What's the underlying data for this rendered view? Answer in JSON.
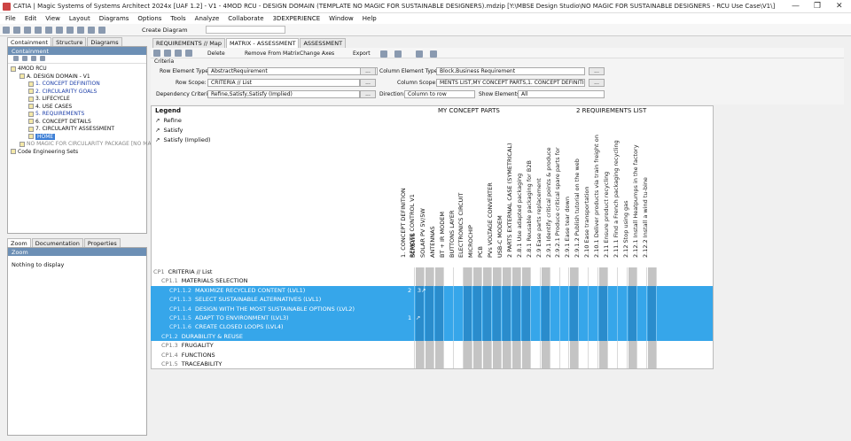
{
  "title": {
    "text": "CATIA | Magic Systems of Systems Architect 2024x [UAF 1.2] - V1 - 4MOD RCU - DESIGN DOMAIN (TEMPLATE NO MAGIC FOR SUSTAINABLE DESIGNERS).mdzip [Y:\\MBSE Design Studio\\NO MAGIC FOR SUSTAINABLE DESIGNERS - RCU Use Case\\V1\\]",
    "minimize": "—",
    "restore": "❐",
    "close": "✕"
  },
  "menu": [
    "File",
    "Edit",
    "View",
    "Layout",
    "Diagrams",
    "Options",
    "Tools",
    "Analyze",
    "Collaborate",
    "3DEXPERIENCE",
    "Window",
    "Help"
  ],
  "toolbar": {
    "create_diagram": "Create Diagram"
  },
  "left_tabs": [
    "Containment",
    "Structure",
    "Diagrams"
  ],
  "containment": {
    "title": "Containment",
    "tree": [
      {
        "label": "4MOD RCU",
        "indent": 0,
        "cls": ""
      },
      {
        "label": "A. DESIGN DOMAIN - V1",
        "indent": 1,
        "cls": ""
      },
      {
        "label": "1. CONCEPT DEFINITION",
        "indent": 2,
        "cls": "blue"
      },
      {
        "label": "2. CIRCULARITY GOALS",
        "indent": 2,
        "cls": "blue"
      },
      {
        "label": "3. LIFECYCLE",
        "indent": 2,
        "cls": ""
      },
      {
        "label": "4. USE CASES",
        "indent": 2,
        "cls": ""
      },
      {
        "label": "5. REQUIREMENTS",
        "indent": 2,
        "cls": "blue"
      },
      {
        "label": "6. CONCEPT DETAILS",
        "indent": 2,
        "cls": ""
      },
      {
        "label": "7. CIRCULARITY ASSESSMENT",
        "indent": 2,
        "cls": ""
      },
      {
        "label": "HOME",
        "indent": 2,
        "cls": "sel"
      },
      {
        "label": "NO MAGIC FOR CIRCULARITY PACKAGE [NO MA",
        "indent": 1,
        "cls": "grey"
      },
      {
        "label": "Code Engineering Sets",
        "indent": 0,
        "cls": ""
      }
    ]
  },
  "bottom_tabs": [
    "Zoom",
    "Documentation",
    "Properties"
  ],
  "zoom": {
    "title": "Zoom",
    "empty": "Nothing to display"
  },
  "editor_tabs": [
    "REQUIREMENTS // Map",
    "MATRIX - ASSESSMENT",
    "ASSESSMENT"
  ],
  "matrix_toolbar": {
    "delete": "Delete",
    "remove": "Remove From Matrix",
    "change_axes": "Change Axes",
    "export": "Export"
  },
  "criteria": {
    "heading": "Criteria",
    "row_type_label": "Row Element Type:",
    "row_type_value": "AbstractRequirement",
    "row_scope_label": "Row Scope:",
    "row_scope_value": "CRITERIA // List",
    "dep_label": "Dependency Criteria:",
    "dep_value": "Refine,Satisfy,Satisfy (Implied)",
    "col_type_label": "Column Element Type:",
    "col_type_value": "Block,Business Requirement",
    "col_scope_label": "Column Scope:",
    "col_scope_value": "MENTS LIST,MY CONCEPT PARTS,1. CONCEPT DEFINITION",
    "direction_label": "Direction:",
    "direction_value": "Column to row",
    "show_label": "Show Elements:",
    "show_value": "All",
    "dots": "...",
    "sn": "(S)"
  },
  "legend": {
    "title": "Legend",
    "items": [
      "Refine",
      "Satisfy",
      "Satisfy (Implied)"
    ]
  },
  "col_groups": {
    "parts": "MY CONCEPT PARTS",
    "reqs": "2 REQUIREMENTS LIST"
  },
  "columns": [
    {
      "label": "1. CONCEPT DEFINITION",
      "sub": "REMOTE CONTROL V1"
    },
    {
      "label": "SCREWS"
    },
    {
      "label": "SOLAR PV 5V/5W"
    },
    {
      "label": "ANTENNAS"
    },
    {
      "label": "BT + IR MODEM"
    },
    {
      "label": "BUTTONS LAYER"
    },
    {
      "label": "ELECTRONICS CIRCUIT"
    },
    {
      "label": "MICROCHIP"
    },
    {
      "label": "PCB"
    },
    {
      "label": "PVs VOLTAGE CONVERTER"
    },
    {
      "label": "USB-C MODEM"
    },
    {
      "label": "2 PARTS EXTERNAL CASE (SYMETRICAL)"
    },
    {
      "label": "2.8.1 Use adapted packaging"
    },
    {
      "label": "2.8.1 Reusable packaging for B2B"
    },
    {
      "label": "2.9 Ease parts replacement"
    },
    {
      "label": "2.9.1 Identify critical points & produce"
    },
    {
      "label": "2.9.2.1 Produce critical spare parts for"
    },
    {
      "label": "2.9.1 Ease tear down"
    },
    {
      "label": "2.9.1.2 Publish tutorial on the web"
    },
    {
      "label": "2.10 Ease transportation"
    },
    {
      "label": "2.10.1 Deliver products via train freight on"
    },
    {
      "label": "2.11 Ensure product recycling"
    },
    {
      "label": "2.11.1 Find a French packaging recycling"
    },
    {
      "label": "2.12 Stop using gas"
    },
    {
      "label": "2.12.1 Install Heatpumps in the factory"
    },
    {
      "label": "2.12.2 Install a wind tu-bine"
    }
  ],
  "rows": [
    {
      "code": "CP1",
      "label": "CRITERIA // List",
      "indent": 0,
      "sel": false
    },
    {
      "code": "CP1.1",
      "label": "MATERIALS SELECTION",
      "indent": 1,
      "sel": false
    },
    {
      "code": "CP1.1.2",
      "label": "MAXIMIZE RECYCLED CONTENT (LVL1)",
      "indent": 2,
      "sel": true,
      "count": "2",
      "n3": "3"
    },
    {
      "code": "CP1.1.3",
      "label": "SELECT SUSTAINABLE ALTERNATIVES (LVL1)",
      "indent": 2,
      "sel": true
    },
    {
      "code": "CP1.1.4",
      "label": "DESIGN WITH THE MOST SUSTAINABLE OPTIONS (LVL2)",
      "indent": 2,
      "sel": true
    },
    {
      "code": "CP1.1.5",
      "label": "ADAPT TO ENVIRONMENT (LVL3)",
      "indent": 2,
      "sel": true,
      "count": "1"
    },
    {
      "code": "CP1.1.6",
      "label": "CREATE CLOSED LOOPS (LVL4)",
      "indent": 2,
      "sel": true
    },
    {
      "code": "CP1.2",
      "label": "DURABILITY & REUSE",
      "indent": 1,
      "sel": true
    },
    {
      "code": "CP1.3",
      "label": "FRUGALITY",
      "indent": 1,
      "sel": false
    },
    {
      "code": "CP1.4",
      "label": "FUNCTIONS",
      "indent": 1,
      "sel": false
    },
    {
      "code": "CP1.5",
      "label": "TRACEABILITY",
      "indent": 1,
      "sel": false
    }
  ],
  "arrow": "↗",
  "colors": {
    "selected_row": "#36a6ea",
    "header": "#6c8fb5"
  }
}
